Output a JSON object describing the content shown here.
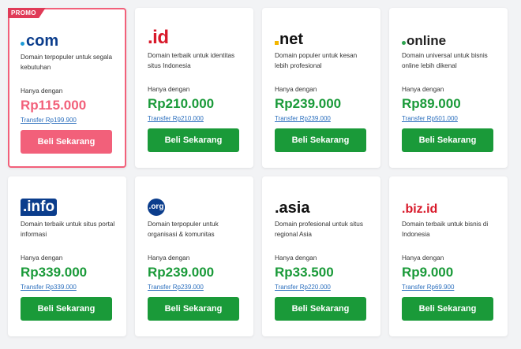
{
  "colors": {
    "price_green": "#1a9a39",
    "promo_pink": "#f2607a",
    "promo_tag_red": "#e03a57",
    "link_blue": "#2a6ebd"
  },
  "promo_label": "PROMO",
  "cards": [
    {
      "logo": ".com",
      "logo_text": "com",
      "desc": "Domain terpopuler untuk segala kebutuhan",
      "hanya": "Hanya dengan",
      "price": "Rp115.000",
      "transfer": "Transfer Rp199.900",
      "button": "Beli Sekarang"
    },
    {
      "logo": ".id",
      "logo_text": ".id",
      "desc": "Domain terbaik untuk identitas situs Indonesia",
      "hanya": "Hanya dengan",
      "price": "Rp210.000",
      "transfer": "Transfer Rp210.000",
      "button": "Beli Sekarang"
    },
    {
      "logo": ".net",
      "logo_text": "net",
      "desc": "Domain populer untuk kesan lebih profesional",
      "hanya": "Hanya dengan",
      "price": "Rp239.000",
      "transfer": "Transfer Rp239.000",
      "button": "Beli Sekarang"
    },
    {
      "logo": ".online",
      "logo_text": "online",
      "desc": "Domain universal untuk bisnis online lebih dikenal",
      "hanya": "Hanya dengan",
      "price": "Rp89.000",
      "transfer": "Transfer Rp501.000",
      "button": "Beli Sekarang"
    },
    {
      "logo": ".info",
      "logo_text": ".info",
      "desc": "Domain terbaik untuk situs portal informasi",
      "hanya": "Hanya dengan",
      "price": "Rp339.000",
      "transfer": "Transfer Rp339.000",
      "button": "Beli Sekarang"
    },
    {
      "logo": ".org",
      "logo_text": ".org",
      "desc": "Domain terpopuler untuk organisasi & komunitas",
      "hanya": "Hanya dengan",
      "price": "Rp239.000",
      "transfer": "Transfer Rp239.000",
      "button": "Beli Sekarang"
    },
    {
      "logo": ".asia",
      "logo_text": ".asia",
      "desc": "Domain profesional untuk situs regional Asia",
      "hanya": "Hanya dengan",
      "price": "Rp33.500",
      "transfer": "Transfer Rp220.000",
      "button": "Beli Sekarang"
    },
    {
      "logo": ".biz.id",
      "logo_text": ".biz.id",
      "desc": "Domain terbaik untuk bisnis di Indonesia",
      "hanya": "Hanya dengan",
      "price": "Rp9.000",
      "transfer": "Transfer Rp69.900",
      "button": "Beli Sekarang"
    }
  ]
}
